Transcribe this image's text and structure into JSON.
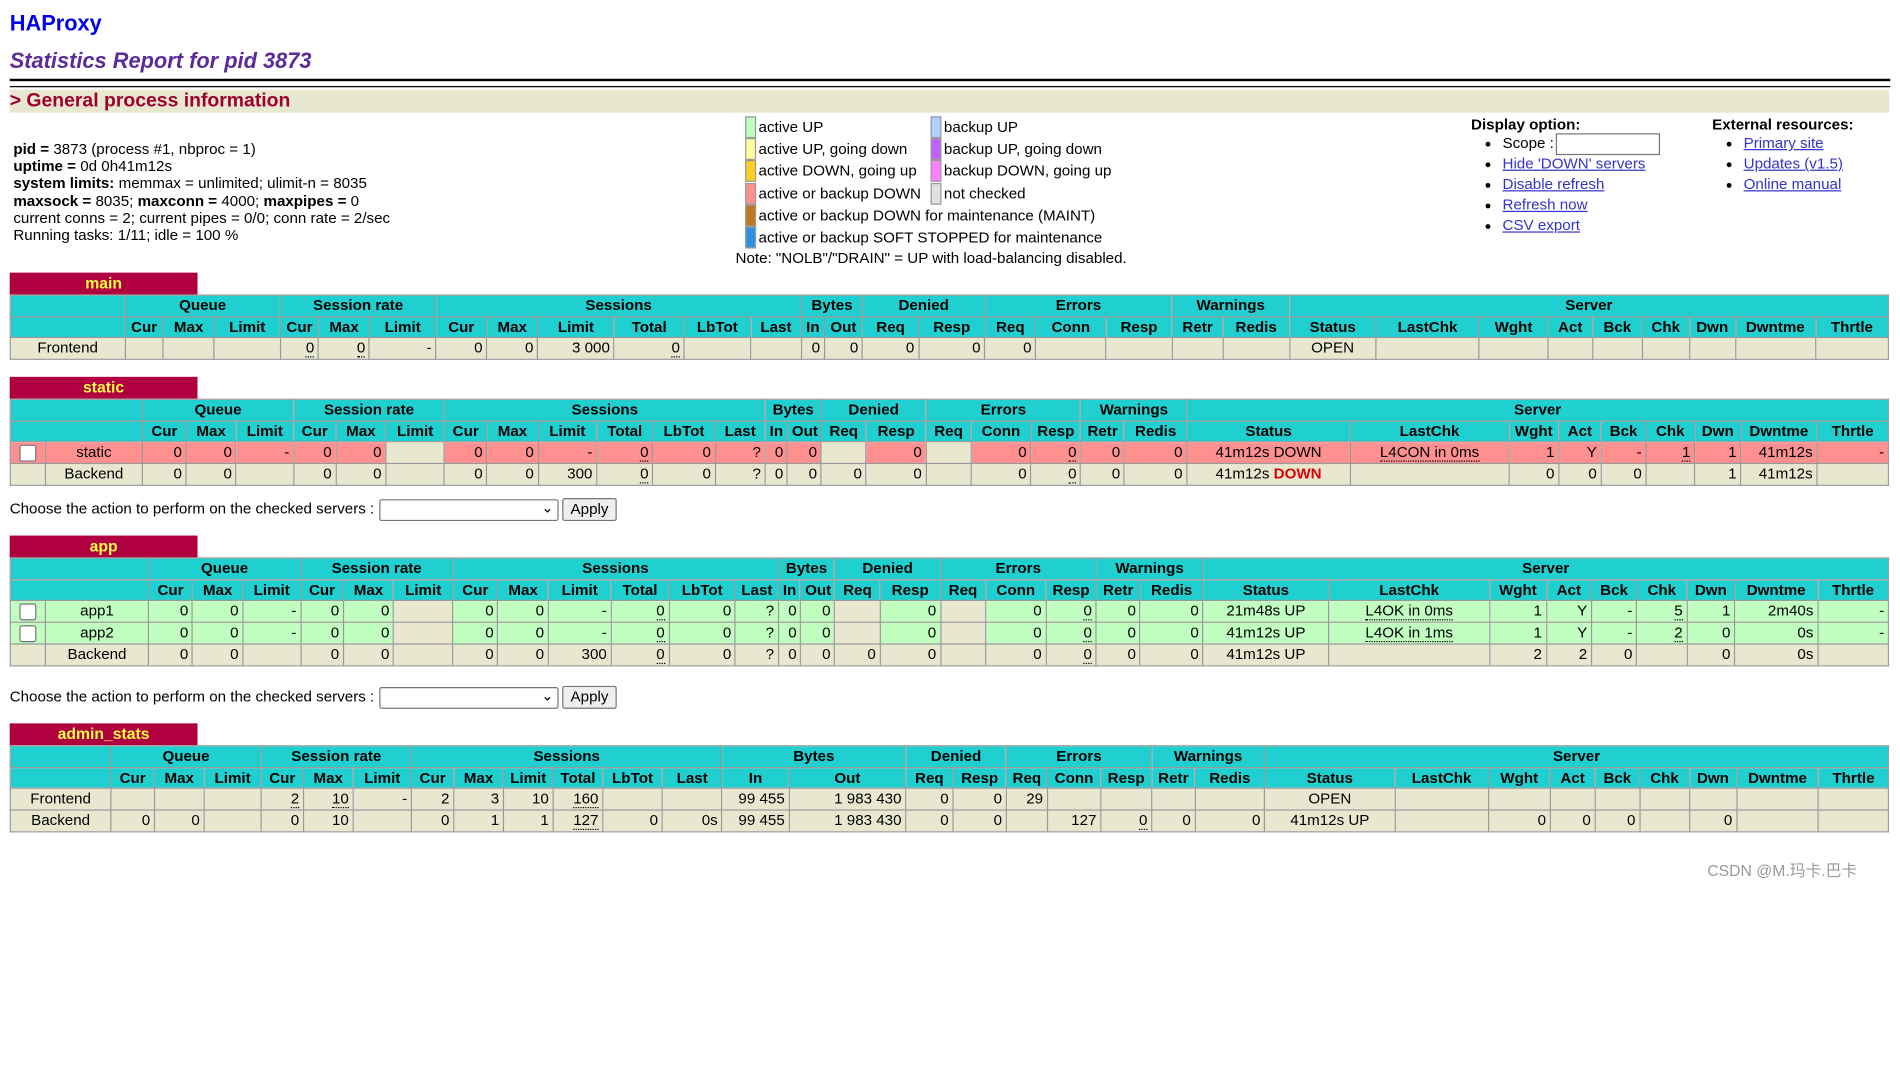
{
  "header": {
    "title": "HAProxy",
    "subtitle": "Statistics Report for pid 3873",
    "section": "> General process information"
  },
  "process_info": {
    "pid_label": "pid =",
    "pid_value": "3873 (process #1, nbproc = 1)",
    "uptime_label": "uptime =",
    "uptime_value": "0d 0h41m12s",
    "limits_label": "system limits:",
    "limits_value": "memmax = unlimited; ulimit-n = 8035",
    "maxsock_label": "maxsock =",
    "maxsock_value": "8035;",
    "maxconn_label": "maxconn =",
    "maxconn_value": "4000;",
    "maxpipes_label": "maxpipes =",
    "maxpipes_value": "0",
    "current": "current conns = 2; current pipes = 0/0; conn rate = 2/sec",
    "tasks": "Running tasks: 1/11; idle = 100 %"
  },
  "legend": {
    "items": [
      {
        "label": "active UP",
        "color": "#c0ffc0"
      },
      {
        "label": "active UP, going down",
        "color": "#ffffa0"
      },
      {
        "label": "active DOWN, going up",
        "color": "#ffd020"
      },
      {
        "label": "active or backup DOWN",
        "color": "#ff9090"
      },
      {
        "label": "active or backup DOWN for maintenance (MAINT)",
        "color": "#c07820"
      },
      {
        "label": "active or backup SOFT STOPPED for maintenance",
        "color": "#3090e0"
      },
      {
        "label": "backup UP",
        "color": "#b0d0ff"
      },
      {
        "label": "backup UP, going down",
        "color": "#c060ff"
      },
      {
        "label": "backup DOWN, going up",
        "color": "#ff80ff"
      },
      {
        "label": "not checked",
        "color": "#e0e0e0"
      }
    ],
    "note": "Note: \"NOLB\"/\"DRAIN\" = UP with load-balancing disabled."
  },
  "display_options": {
    "title": "Display option:",
    "scope_label": "Scope :",
    "links": [
      "Hide 'DOWN' servers",
      "Disable refresh",
      "Refresh now",
      "CSV export"
    ]
  },
  "external": {
    "title": "External resources:",
    "links": [
      "Primary site",
      "Updates (v1.5)",
      "Online manual"
    ]
  },
  "columns": {
    "groups": [
      "Queue",
      "Session rate",
      "Sessions",
      "Bytes",
      "Denied",
      "Errors",
      "Warnings",
      "Server"
    ],
    "sub": [
      "Cur",
      "Max",
      "Limit",
      "Cur",
      "Max",
      "Limit",
      "Cur",
      "Max",
      "Limit",
      "Total",
      "LbTot",
      "Last",
      "In",
      "Out",
      "Req",
      "Resp",
      "Req",
      "Conn",
      "Resp",
      "Retr",
      "Redis",
      "Status",
      "LastChk",
      "Wght",
      "Act",
      "Bck",
      "Chk",
      "Dwn",
      "Dwntme",
      "Thrtle"
    ]
  },
  "proxies": {
    "main": {
      "name": "main",
      "frontend": {
        "name": "Frontend",
        "cells": [
          "",
          "",
          "",
          "0",
          "0",
          "-",
          "0",
          "0",
          "3 000",
          "0",
          "",
          "",
          "0",
          "0",
          "0",
          "0",
          "0",
          "",
          "",
          "",
          "",
          "OPEN",
          "",
          "",
          "",
          "",
          "",
          "",
          "",
          ""
        ]
      }
    },
    "static": {
      "name": "static",
      "rows": [
        {
          "name": "static",
          "cells": [
            "0",
            "0",
            "-",
            "0",
            "0",
            "",
            "0",
            "0",
            "-",
            "0",
            "0",
            "?",
            "0",
            "0",
            "",
            "0",
            "",
            "0",
            "0",
            "0",
            "0",
            "41m12s DOWN",
            "L4CON in 0ms",
            "1",
            "Y",
            "-",
            "1",
            "1",
            "41m12s",
            "-"
          ]
        },
        {
          "name": "Backend",
          "cells": [
            "0",
            "0",
            "",
            "0",
            "0",
            "",
            "0",
            "0",
            "300",
            "0",
            "0",
            "?",
            "0",
            "0",
            "0",
            "0",
            "",
            "0",
            "0",
            "0",
            "0",
            "41m12s",
            "",
            "0",
            "0",
            "0",
            "",
            "1",
            "41m12s",
            ""
          ],
          "status_word": "DOWN"
        }
      ]
    },
    "app": {
      "name": "app",
      "rows": [
        {
          "name": "app1",
          "cells": [
            "0",
            "0",
            "-",
            "0",
            "0",
            "",
            "0",
            "0",
            "-",
            "0",
            "0",
            "?",
            "0",
            "0",
            "",
            "0",
            "",
            "0",
            "0",
            "0",
            "0",
            "21m48s UP",
            "L4OK in 0ms",
            "1",
            "Y",
            "-",
            "5",
            "1",
            "2m40s",
            "-"
          ]
        },
        {
          "name": "app2",
          "cells": [
            "0",
            "0",
            "-",
            "0",
            "0",
            "",
            "0",
            "0",
            "-",
            "0",
            "0",
            "?",
            "0",
            "0",
            "",
            "0",
            "",
            "0",
            "0",
            "0",
            "0",
            "41m12s UP",
            "L4OK in 1ms",
            "1",
            "Y",
            "-",
            "2",
            "0",
            "0s",
            "-"
          ]
        },
        {
          "name": "Backend",
          "cells": [
            "0",
            "0",
            "",
            "0",
            "0",
            "",
            "0",
            "0",
            "300",
            "0",
            "0",
            "?",
            "0",
            "0",
            "0",
            "0",
            "",
            "0",
            "0",
            "0",
            "0",
            "41m12s UP",
            "",
            "2",
            "2",
            "0",
            "",
            "0",
            "0s",
            ""
          ]
        }
      ]
    },
    "admin_stats": {
      "name": "admin_stats",
      "rows": [
        {
          "name": "Frontend",
          "cells": [
            "",
            "",
            "",
            "2",
            "10",
            "-",
            "2",
            "3",
            "10",
            "160",
            "",
            "",
            "99 455",
            "1 983 430",
            "0",
            "0",
            "29",
            "",
            "",
            "",
            "",
            "OPEN",
            "",
            "",
            "",
            "",
            "",
            "",
            "",
            ""
          ]
        },
        {
          "name": "Backend",
          "cells": [
            "0",
            "0",
            "",
            "0",
            "10",
            "",
            "0",
            "1",
            "1",
            "127",
            "0",
            "0s",
            "99 455",
            "1 983 430",
            "0",
            "0",
            "",
            "127",
            "0",
            "0",
            "0",
            "41m12s UP",
            "",
            "0",
            "0",
            "0",
            "",
            "0",
            "",
            ""
          ]
        }
      ]
    }
  },
  "action": {
    "label": "Choose the action to perform on the checked servers :",
    "apply": "Apply"
  },
  "watermark": "CSDN @M.玛卡.巴卡"
}
